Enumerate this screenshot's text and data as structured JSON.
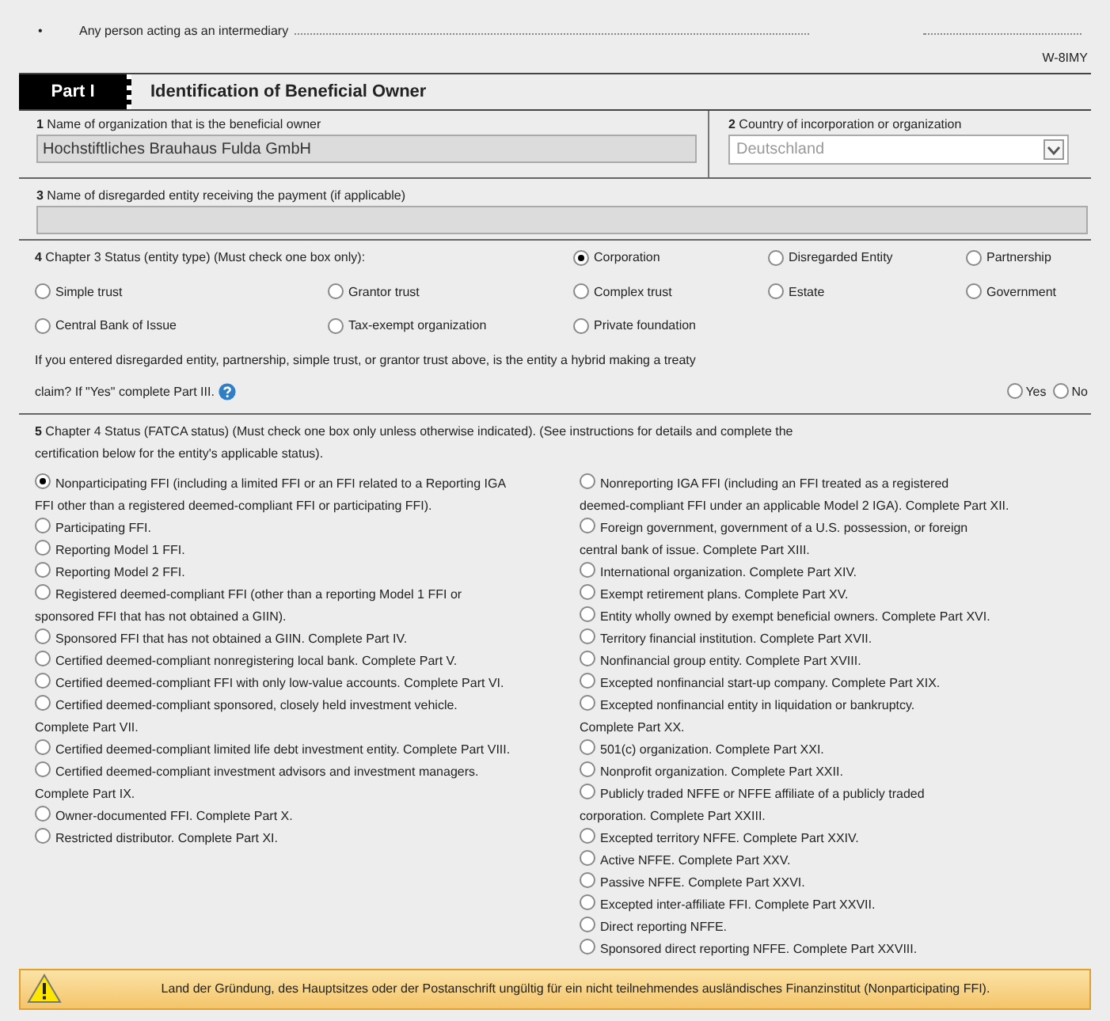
{
  "intermediary": {
    "bullet": "•",
    "label": "Any person acting as an intermediary",
    "form": "W-8IMY"
  },
  "part": {
    "label": "Part I",
    "title": "Identification of Beneficial Owner"
  },
  "field1": {
    "number": "1",
    "label": "Name of organization that is the beneficial owner",
    "value": "Hochstiftliches Brauhaus Fulda GmbH"
  },
  "field2": {
    "number": "2",
    "label": "Country of incorporation or organization",
    "value": "Deutschland"
  },
  "field3": {
    "number": "3",
    "label": "Name of disregarded entity receiving the payment (if applicable)"
  },
  "chapter3": {
    "number": "4",
    "label": "Chapter 3 Status (entity type) (Must check one box only):",
    "options": [
      {
        "label": "Corporation",
        "selected": true
      },
      {
        "label": "Disregarded Entity",
        "selected": false
      },
      {
        "label": "Partnership",
        "selected": false
      },
      {
        "label": "Simple trust",
        "selected": false
      },
      {
        "label": "Grantor trust",
        "selected": false
      },
      {
        "label": "Complex trust",
        "selected": false
      },
      {
        "label": "Estate",
        "selected": false
      },
      {
        "label": "Government",
        "selected": false
      },
      {
        "label": "Central Bank of Issue",
        "selected": false
      },
      {
        "label": "Tax-exempt organization",
        "selected": false
      },
      {
        "label": "Private foundation",
        "selected": false
      }
    ]
  },
  "hybrid": {
    "line1": "If you entered disregarded entity, partnership, simple trust, or grantor trust above, is the entity a hybrid making a treaty",
    "line2": "claim? If \"Yes\" complete Part III.",
    "options": [
      {
        "label": "Yes",
        "selected": false
      },
      {
        "label": "No",
        "selected": false
      }
    ]
  },
  "chapter4": {
    "number": "5",
    "line1": "Chapter 4 Status (FATCA status) (Must check one box only unless otherwise indicated). (See instructions for details and complete the",
    "line2": "certification below for the entity's applicable status).",
    "left": [
      {
        "label": "Nonparticipating FFI (including a limited FFI or an FFI related to a Reporting IGA",
        "continued": "FFI other than a registered deemed-compliant FFI or participating FFI).",
        "selected": true
      },
      {
        "label": "Participating FFI.",
        "selected": false
      },
      {
        "label": "Reporting Model 1 FFI.",
        "selected": false
      },
      {
        "label": "Reporting Model 2 FFI.",
        "selected": false
      },
      {
        "label": "Registered deemed-compliant FFI (other than a reporting Model 1 FFI or",
        "continued": "sponsored FFI that has not obtained a GIIN).",
        "selected": false
      },
      {
        "label": "Sponsored FFI that has not obtained a GIIN. Complete Part IV.",
        "selected": false
      },
      {
        "label": "Certified deemed-compliant nonregistering local bank. Complete Part V.",
        "selected": false
      },
      {
        "label": "Certified deemed-compliant FFI with only low-value accounts. Complete Part VI.",
        "selected": false
      },
      {
        "label": "Certified deemed-compliant sponsored, closely held investment vehicle.",
        "continued": "Complete Part VII.",
        "selected": false
      },
      {
        "label": "Certified deemed-compliant limited life debt investment entity. Complete Part VIII.",
        "selected": false
      },
      {
        "label": "Certified deemed-compliant investment advisors and investment managers.",
        "continued": "Complete Part IX.",
        "selected": false
      },
      {
        "label": "Owner-documented FFI. Complete Part X.",
        "selected": false
      },
      {
        "label": "Restricted distributor. Complete Part XI.",
        "selected": false
      }
    ],
    "right": [
      {
        "label": "Nonreporting IGA FFI (including an FFI treated as a registered",
        "continued": "deemed-compliant FFI under an applicable Model 2 IGA). Complete Part XII.",
        "selected": false
      },
      {
        "label": "Foreign government, government of a U.S. possession, or foreign",
        "continued": "central bank of issue. Complete Part XIII.",
        "selected": false
      },
      {
        "label": "International organization. Complete Part XIV.",
        "selected": false
      },
      {
        "label": "Exempt retirement plans. Complete Part XV.",
        "selected": false
      },
      {
        "label": "Entity wholly owned by exempt beneficial owners. Complete Part XVI.",
        "selected": false
      },
      {
        "label": "Territory financial institution. Complete Part XVII.",
        "selected": false
      },
      {
        "label": "Nonfinancial group entity. Complete Part XVIII.",
        "selected": false
      },
      {
        "label": "Excepted nonfinancial start-up company. Complete Part XIX.",
        "selected": false
      },
      {
        "label": "Excepted nonfinancial entity in liquidation or bankruptcy.",
        "continued": "Complete Part XX.",
        "selected": false
      },
      {
        "label": "501(c) organization. Complete Part XXI.",
        "selected": false
      },
      {
        "label": "Nonprofit organization. Complete Part XXII.",
        "selected": false
      },
      {
        "label": "Publicly traded NFFE or NFFE affiliate of a publicly traded",
        "continued": "corporation. Complete Part XXIII.",
        "selected": false
      },
      {
        "label": "Excepted territory NFFE. Complete Part XXIV.",
        "selected": false
      },
      {
        "label": "Active NFFE. Complete Part XXV.",
        "selected": false
      },
      {
        "label": "Passive NFFE. Complete Part XXVI.",
        "selected": false
      },
      {
        "label": "Excepted inter-affiliate FFI. Complete Part XXVII.",
        "selected": false
      },
      {
        "label": "Direct reporting NFFE.",
        "selected": false
      },
      {
        "label": "Sponsored direct reporting NFFE. Complete Part XXVIII.",
        "selected": false
      }
    ]
  },
  "warning": {
    "message": "Land der Gründung, des Hauptsitzes oder der Postanschrift ungültig für ein nicht teilnehmendes ausländisches Finanzinstitut (Nonparticipating FFI)."
  }
}
